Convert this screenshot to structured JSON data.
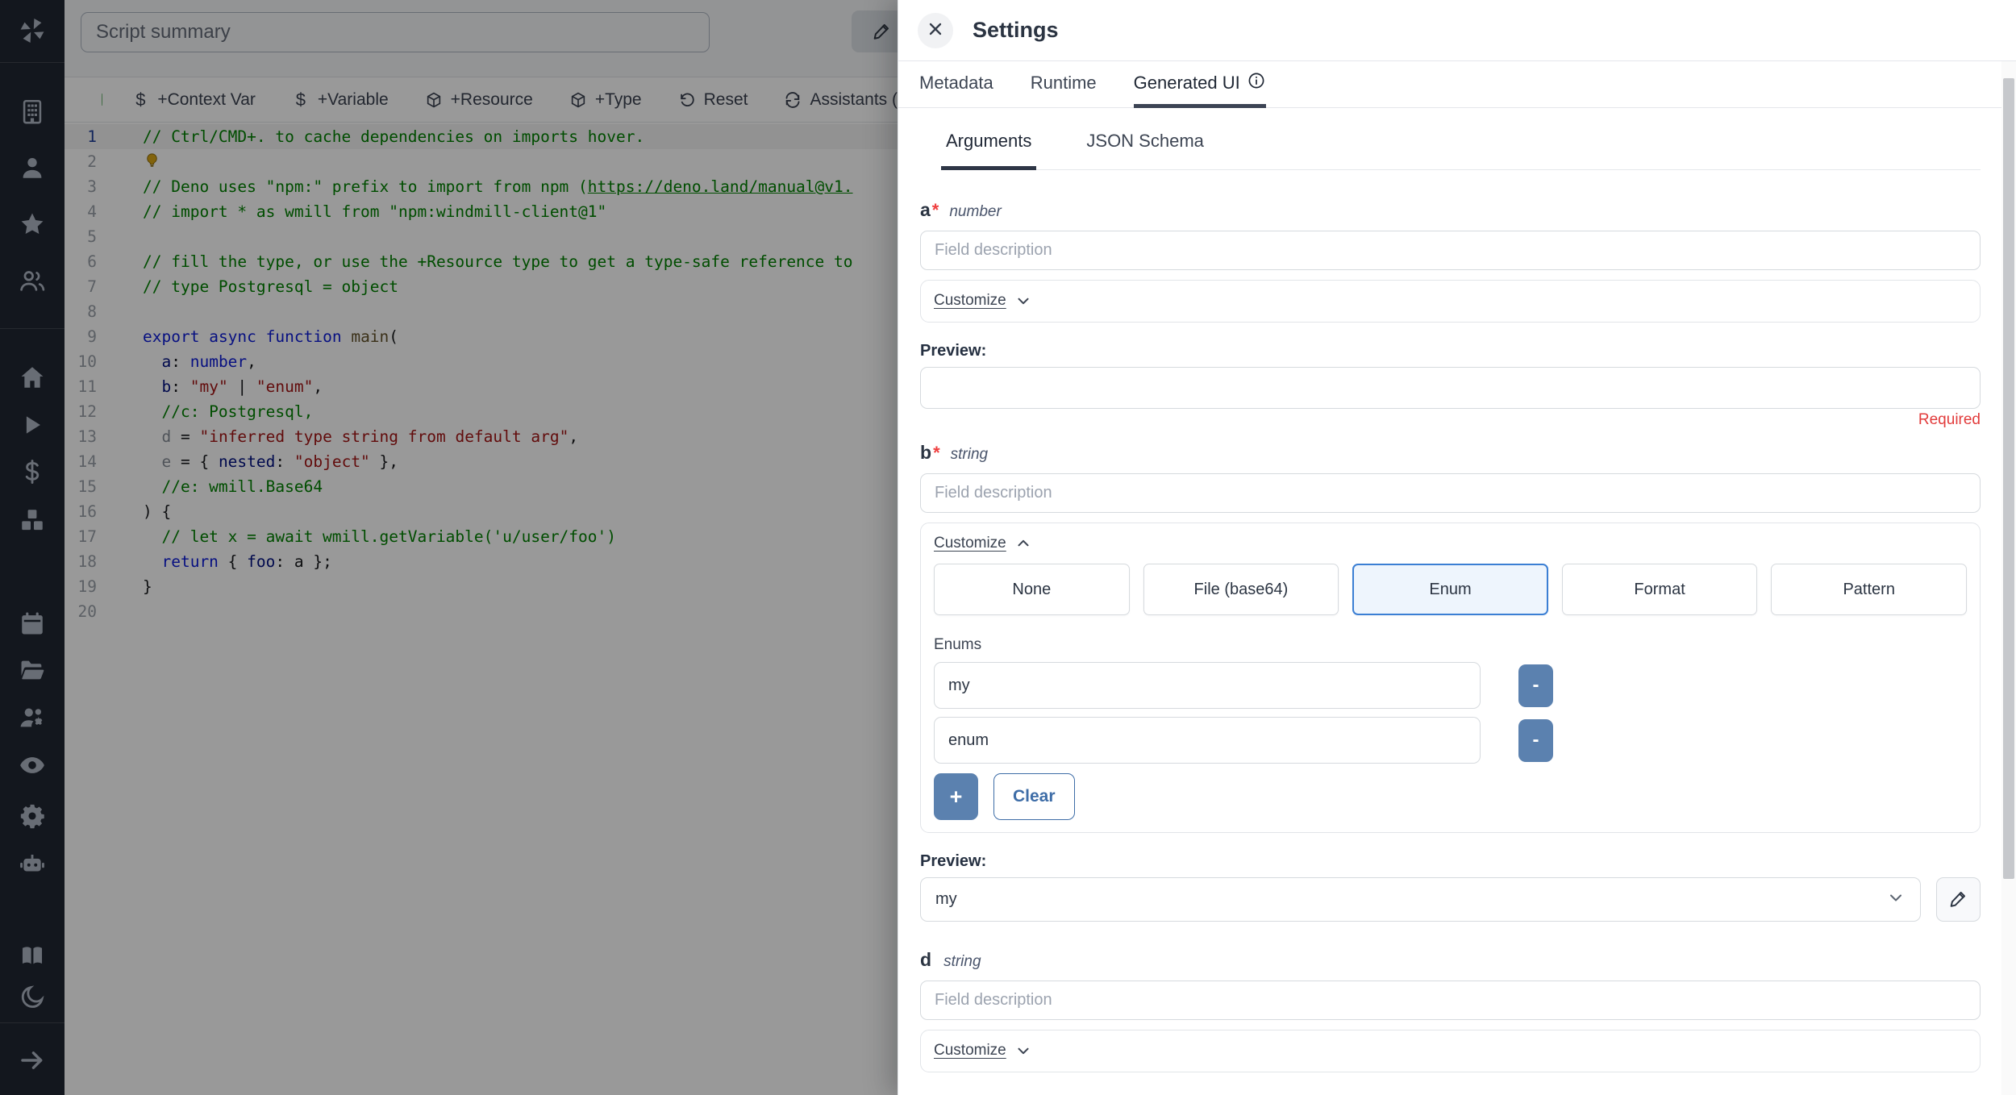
{
  "sidebar": {
    "icons": [
      "windmill-logo",
      "building",
      "user",
      "star",
      "users",
      "home",
      "play",
      "dollar",
      "boxes",
      "calendar",
      "folder-open",
      "user-cog",
      "eye",
      "settings-gear",
      "bot",
      "book-open",
      "moon",
      "arrow-right"
    ]
  },
  "editor": {
    "summary_placeholder": "Script summary",
    "status_color": "#69b36e",
    "toolbar": {
      "items": [
        {
          "icon": "dollar",
          "label": "+Context Var"
        },
        {
          "icon": "dollar",
          "label": "+Variable"
        },
        {
          "icon": "package",
          "label": "+Resource"
        },
        {
          "icon": "package",
          "label": "+Type"
        },
        {
          "icon": "undo",
          "label": "Reset"
        },
        {
          "icon": "refresh",
          "label": "Assistants ("
        }
      ]
    },
    "code_lines": [
      {
        "n": 1,
        "current": true,
        "tokens": [
          [
            "// Ctrl/CMD+. to cache dependencies on imports hover.",
            "c"
          ]
        ]
      },
      {
        "n": 2,
        "current": false,
        "tokens": [
          [
            "__BULB__",
            "bulb"
          ]
        ]
      },
      {
        "n": 3,
        "current": false,
        "tokens": [
          [
            "// Deno uses \"npm:\" prefix to import from npm (",
            "c"
          ],
          [
            "https://deno.land/manual@v1.",
            "cu"
          ]
        ]
      },
      {
        "n": 4,
        "current": false,
        "tokens": [
          [
            "// import * as wmill from \"npm:windmill-client@1\"",
            "c"
          ]
        ]
      },
      {
        "n": 5,
        "current": false,
        "tokens": []
      },
      {
        "n": 6,
        "current": false,
        "tokens": [
          [
            "// fill the type, or use the +Resource type to get a type-safe reference to",
            "c"
          ]
        ]
      },
      {
        "n": 7,
        "current": false,
        "tokens": [
          [
            "// type Postgresql = object",
            "c"
          ]
        ]
      },
      {
        "n": 8,
        "current": false,
        "tokens": []
      },
      {
        "n": 9,
        "current": false,
        "tokens": [
          [
            "export",
            "k"
          ],
          [
            " ",
            "p"
          ],
          [
            "async",
            "k"
          ],
          [
            " ",
            "p"
          ],
          [
            "function",
            "k"
          ],
          [
            " ",
            "p"
          ],
          [
            "main",
            "fn"
          ],
          [
            "(",
            "p"
          ]
        ]
      },
      {
        "n": 10,
        "current": false,
        "tokens": [
          [
            "  a",
            "v"
          ],
          [
            ": ",
            "p"
          ],
          [
            "number",
            "k"
          ],
          [
            ",",
            "p"
          ]
        ]
      },
      {
        "n": 11,
        "current": false,
        "tokens": [
          [
            "  b",
            "v"
          ],
          [
            ": ",
            "p"
          ],
          [
            "\"my\"",
            "s"
          ],
          [
            " | ",
            "p"
          ],
          [
            "\"enum\"",
            "s"
          ],
          [
            ",",
            "p"
          ]
        ]
      },
      {
        "n": 12,
        "current": false,
        "tokens": [
          [
            "  //c: Postgresql,",
            "c"
          ]
        ]
      },
      {
        "n": 13,
        "current": false,
        "tokens": [
          [
            "  d",
            "dim"
          ],
          [
            " = ",
            "p"
          ],
          [
            "\"inferred type string from default arg\"",
            "s"
          ],
          [
            ",",
            "p"
          ]
        ]
      },
      {
        "n": 14,
        "current": false,
        "tokens": [
          [
            "  e",
            "dim"
          ],
          [
            " = { ",
            "p"
          ],
          [
            "nested",
            "v"
          ],
          [
            ": ",
            "p"
          ],
          [
            "\"object\"",
            "s"
          ],
          [
            " },",
            "p"
          ]
        ]
      },
      {
        "n": 15,
        "current": false,
        "tokens": [
          [
            "  //e: wmill.Base64",
            "c"
          ]
        ]
      },
      {
        "n": 16,
        "current": false,
        "tokens": [
          [
            ") {",
            "p"
          ]
        ]
      },
      {
        "n": 17,
        "current": false,
        "tokens": [
          [
            "  // let x = await wmill.getVariable('u/user/foo')",
            "c"
          ]
        ]
      },
      {
        "n": 18,
        "current": false,
        "tokens": [
          [
            "  return",
            "k"
          ],
          [
            " { ",
            "p"
          ],
          [
            "foo",
            "v"
          ],
          [
            ": ",
            "p"
          ],
          [
            "a",
            "p"
          ],
          [
            " };",
            "p"
          ]
        ]
      },
      {
        "n": 19,
        "current": false,
        "tokens": [
          [
            "}",
            "p"
          ]
        ]
      },
      {
        "n": 20,
        "current": false,
        "tokens": []
      }
    ]
  },
  "panel": {
    "title": "Settings",
    "tabs": [
      {
        "label": "Metadata",
        "active": false
      },
      {
        "label": "Runtime",
        "active": false
      },
      {
        "label": "Generated UI",
        "active": true,
        "info": true
      }
    ],
    "subtabs": [
      {
        "label": "Arguments",
        "active": true
      },
      {
        "label": "JSON Schema",
        "active": false
      }
    ],
    "fields": [
      {
        "name": "a",
        "required_mark": "*",
        "type": "number",
        "description_placeholder": "Field description",
        "customize_label": "Customize",
        "preview_label": "Preview:",
        "preview_value": "",
        "validation": "Required"
      },
      {
        "name": "b",
        "required_mark": "*",
        "type": "string",
        "description_placeholder": "Field description",
        "customize_label": "Customize",
        "variants": [
          {
            "label": "None"
          },
          {
            "label": "File (base64)"
          },
          {
            "label": "Enum"
          },
          {
            "label": "Format"
          },
          {
            "label": "Pattern"
          }
        ],
        "selected_variant": "Enum",
        "enums_label": "Enums",
        "enums": [
          "my",
          "enum"
        ],
        "remove_label": "-",
        "add_label": "+",
        "clear_label": "Clear",
        "preview_label": "Preview:",
        "preview_value": "my"
      },
      {
        "name": "d",
        "required_mark": "",
        "type": "string",
        "description_placeholder": "Field description",
        "customize_label": "Customize"
      }
    ],
    "colors": {
      "accent_blue": "#5b81af",
      "enum_selected_border": "#3b7fd4",
      "enum_selected_bg": "#eef5fd",
      "required_red": "#e23c3c"
    }
  }
}
